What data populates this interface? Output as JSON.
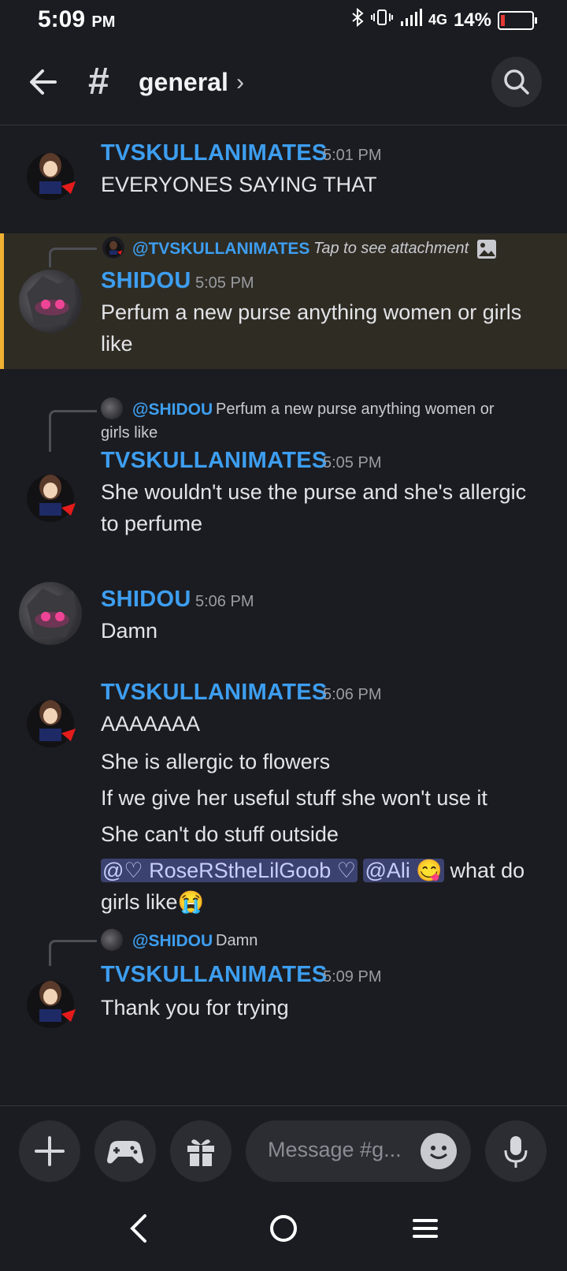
{
  "status_bar": {
    "time": "5:09",
    "ampm": "PM",
    "network": "4G",
    "battery": "14%"
  },
  "header": {
    "channel_symbol": "#",
    "channel_name": "general",
    "chevron": "›"
  },
  "messages": [
    {
      "author": "TVSKULLANIMATES",
      "time": "5:01 PM",
      "lines": [
        "EVERYONES SAYING THAT"
      ]
    },
    {
      "reply": {
        "name": "@TVSKULLANIMATES",
        "text": "Tap to see attachment"
      },
      "author": "SHIDOU",
      "time": "5:05 PM",
      "lines": [
        "Perfum a new purse anything women or girls",
        "like"
      ],
      "highlighted": true
    },
    {
      "reply": {
        "name": "@SHIDOU",
        "text": "Perfum a new purse anything women or",
        "text2": "girls like"
      },
      "author": "TVSKULLANIMATES",
      "time": "5:05 PM",
      "lines": [
        "She wouldn't use the purse and she's allergic",
        "to perfume"
      ]
    },
    {
      "author": "SHIDOU",
      "time": "5:06 PM",
      "lines": [
        "Damn"
      ]
    },
    {
      "author": "TVSKULLANIMATES",
      "time": "5:06 PM",
      "lines": [
        "AAAAAAA",
        "She is allergic to flowers",
        "If we give her useful stuff she won't use it",
        "She can't do stuff outside"
      ],
      "mention1": "@♡ RoseRStheLilGoob ♡",
      "mention2": "@Ali 😋",
      "after_mentions": " what do",
      "last_line": "girls like",
      "last_emoji": "😭"
    },
    {
      "reply": {
        "name": "@SHIDOU",
        "text": "Damn"
      },
      "author": "TVSKULLANIMATES",
      "time": "5:09 PM",
      "lines": [
        "Thank you for trying"
      ]
    }
  ],
  "input": {
    "placeholder": "Message #g..."
  },
  "colors": {
    "background": "#1b1c21",
    "username": "#3d9ef0",
    "highlight": "#2f2c24",
    "highlight_bar": "#f0b132",
    "mention_bg": "#3c4270"
  }
}
